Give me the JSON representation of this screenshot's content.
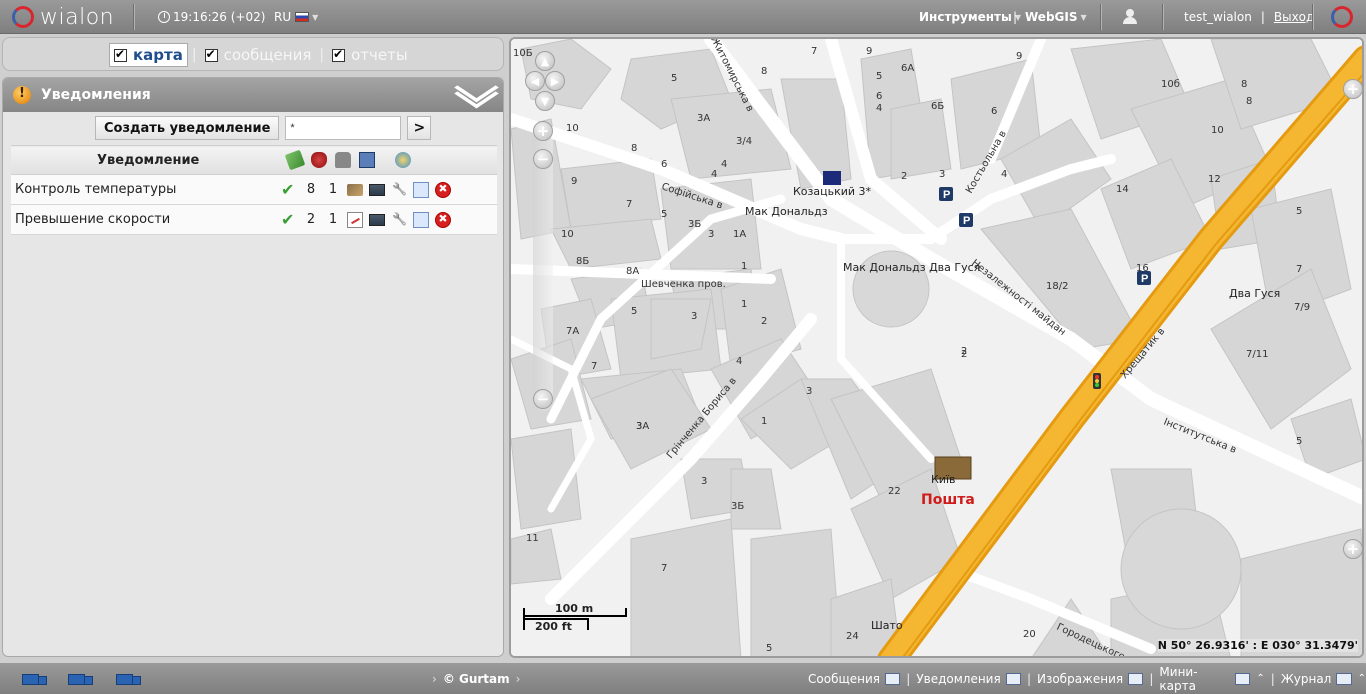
{
  "topbar": {
    "logo_text": "wialon",
    "time": "19:16:26 (+02)",
    "language": "RU",
    "tools_menu": "Инструменты",
    "webgis_menu": "WebGIS",
    "username": "test_wialon",
    "logout": "Выход",
    "brand_color": "#d9262e"
  },
  "tabs": [
    {
      "label": "карта",
      "checked": true,
      "active": true
    },
    {
      "label": "сообщения",
      "checked": true,
      "active": false
    },
    {
      "label": "отчеты",
      "checked": true,
      "active": false
    }
  ],
  "notifications": {
    "panel_title": "Уведомления",
    "create_button": "Создать уведомление",
    "filter_value": "*",
    "go_button": ">",
    "column_header": "Уведомление",
    "rows": [
      {
        "name": "Контроль температуры",
        "units": "8",
        "actions": "1"
      },
      {
        "name": "Превышение скорости",
        "units": "2",
        "actions": "1"
      }
    ]
  },
  "map": {
    "coords": "N 50° 26.9316' : E 030° 31.3479'",
    "scale_m": "100 m",
    "scale_ft": "200 ft",
    "streets": [
      "Софійська в",
      "Шевченка пров.",
      "Костьольна в",
      "Незалежності майдан",
      "Хрещатик в",
      "Інститутська в",
      "Грінченка Бориса в",
      "Городецького",
      "Житомирська в"
    ],
    "pois": [
      "Козацький 3*",
      "Мак Дональдз",
      "Мак Дональдз Два Гуся",
      "Два Гуся",
      "Київ",
      "Пошта",
      "Шато"
    ],
    "post_color": "#d11a1a",
    "road_color": "#f5b731",
    "house_numbers": [
      "10Б",
      "5",
      "8",
      "7",
      "9",
      "5",
      "6А",
      "6",
      "9",
      "8",
      "10б",
      "8",
      "3А",
      "4",
      "4",
      "6Б",
      "6",
      "10",
      "10",
      "8",
      "6",
      "3/4",
      "4",
      "2",
      "3",
      "4",
      "14",
      "12",
      "9",
      "7",
      "5",
      "3Б",
      "3",
      "1А",
      "10",
      "8Б",
      "8А",
      "1",
      "5",
      "1",
      "3",
      "2",
      "4",
      "7А",
      "7",
      "3",
      "3",
      "3А",
      "1",
      "2",
      "18/2",
      "16",
      "5",
      "7",
      "7/9",
      "7/11",
      "5",
      "2",
      "22",
      "3",
      "3Б",
      "11",
      "7",
      "5",
      "24",
      "20"
    ]
  },
  "bottombar": {
    "copyright": "© Gurtam",
    "messages": "Сообщения",
    "notifications": "Уведомления",
    "images": "Изображения",
    "minimap": "Мини-карта",
    "journal": "Журнал"
  }
}
